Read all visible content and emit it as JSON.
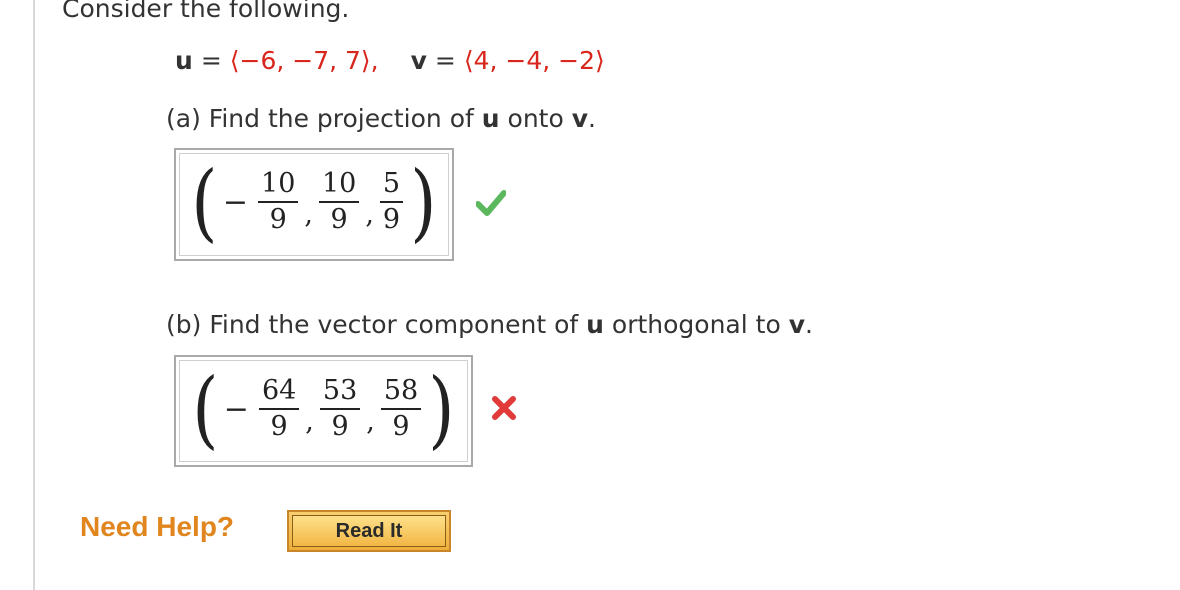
{
  "prompt": "Consider the following.",
  "vectors": {
    "u_name": "u",
    "u_value": "⟨−6, −7, 7⟩,",
    "v_name": "v",
    "v_value": "⟨4, −4, −2⟩",
    "equals": "="
  },
  "part_a": {
    "text_before": "(a) Find the projection of ",
    "bold1": "u",
    "text_middle": " onto ",
    "bold2": "v",
    "text_after": ".",
    "answer": {
      "sign": "−",
      "fractions": [
        {
          "num": "10",
          "den": "9"
        },
        {
          "num": "10",
          "den": "9"
        },
        {
          "num": "5",
          "den": "9"
        }
      ],
      "comma": ","
    },
    "status": "correct",
    "status_icon": "checkmark-icon",
    "status_color": "#5cb85c"
  },
  "part_b": {
    "text_before": "(b) Find the vector component of ",
    "bold1": "u",
    "text_middle": " orthogonal to ",
    "bold2": "v",
    "text_after": ".",
    "answer": {
      "sign": "−",
      "fractions": [
        {
          "num": "64",
          "den": "9"
        },
        {
          "num": "53",
          "den": "9"
        },
        {
          "num": "58",
          "den": "9"
        }
      ],
      "comma": ","
    },
    "status": "incorrect",
    "status_icon": "cross-icon",
    "status_color": "#e03a3a"
  },
  "help": {
    "label": "Need Help?",
    "read_button": "Read It"
  },
  "colors": {
    "red_value": "#d9261c",
    "help_orange": "#e1861e"
  }
}
